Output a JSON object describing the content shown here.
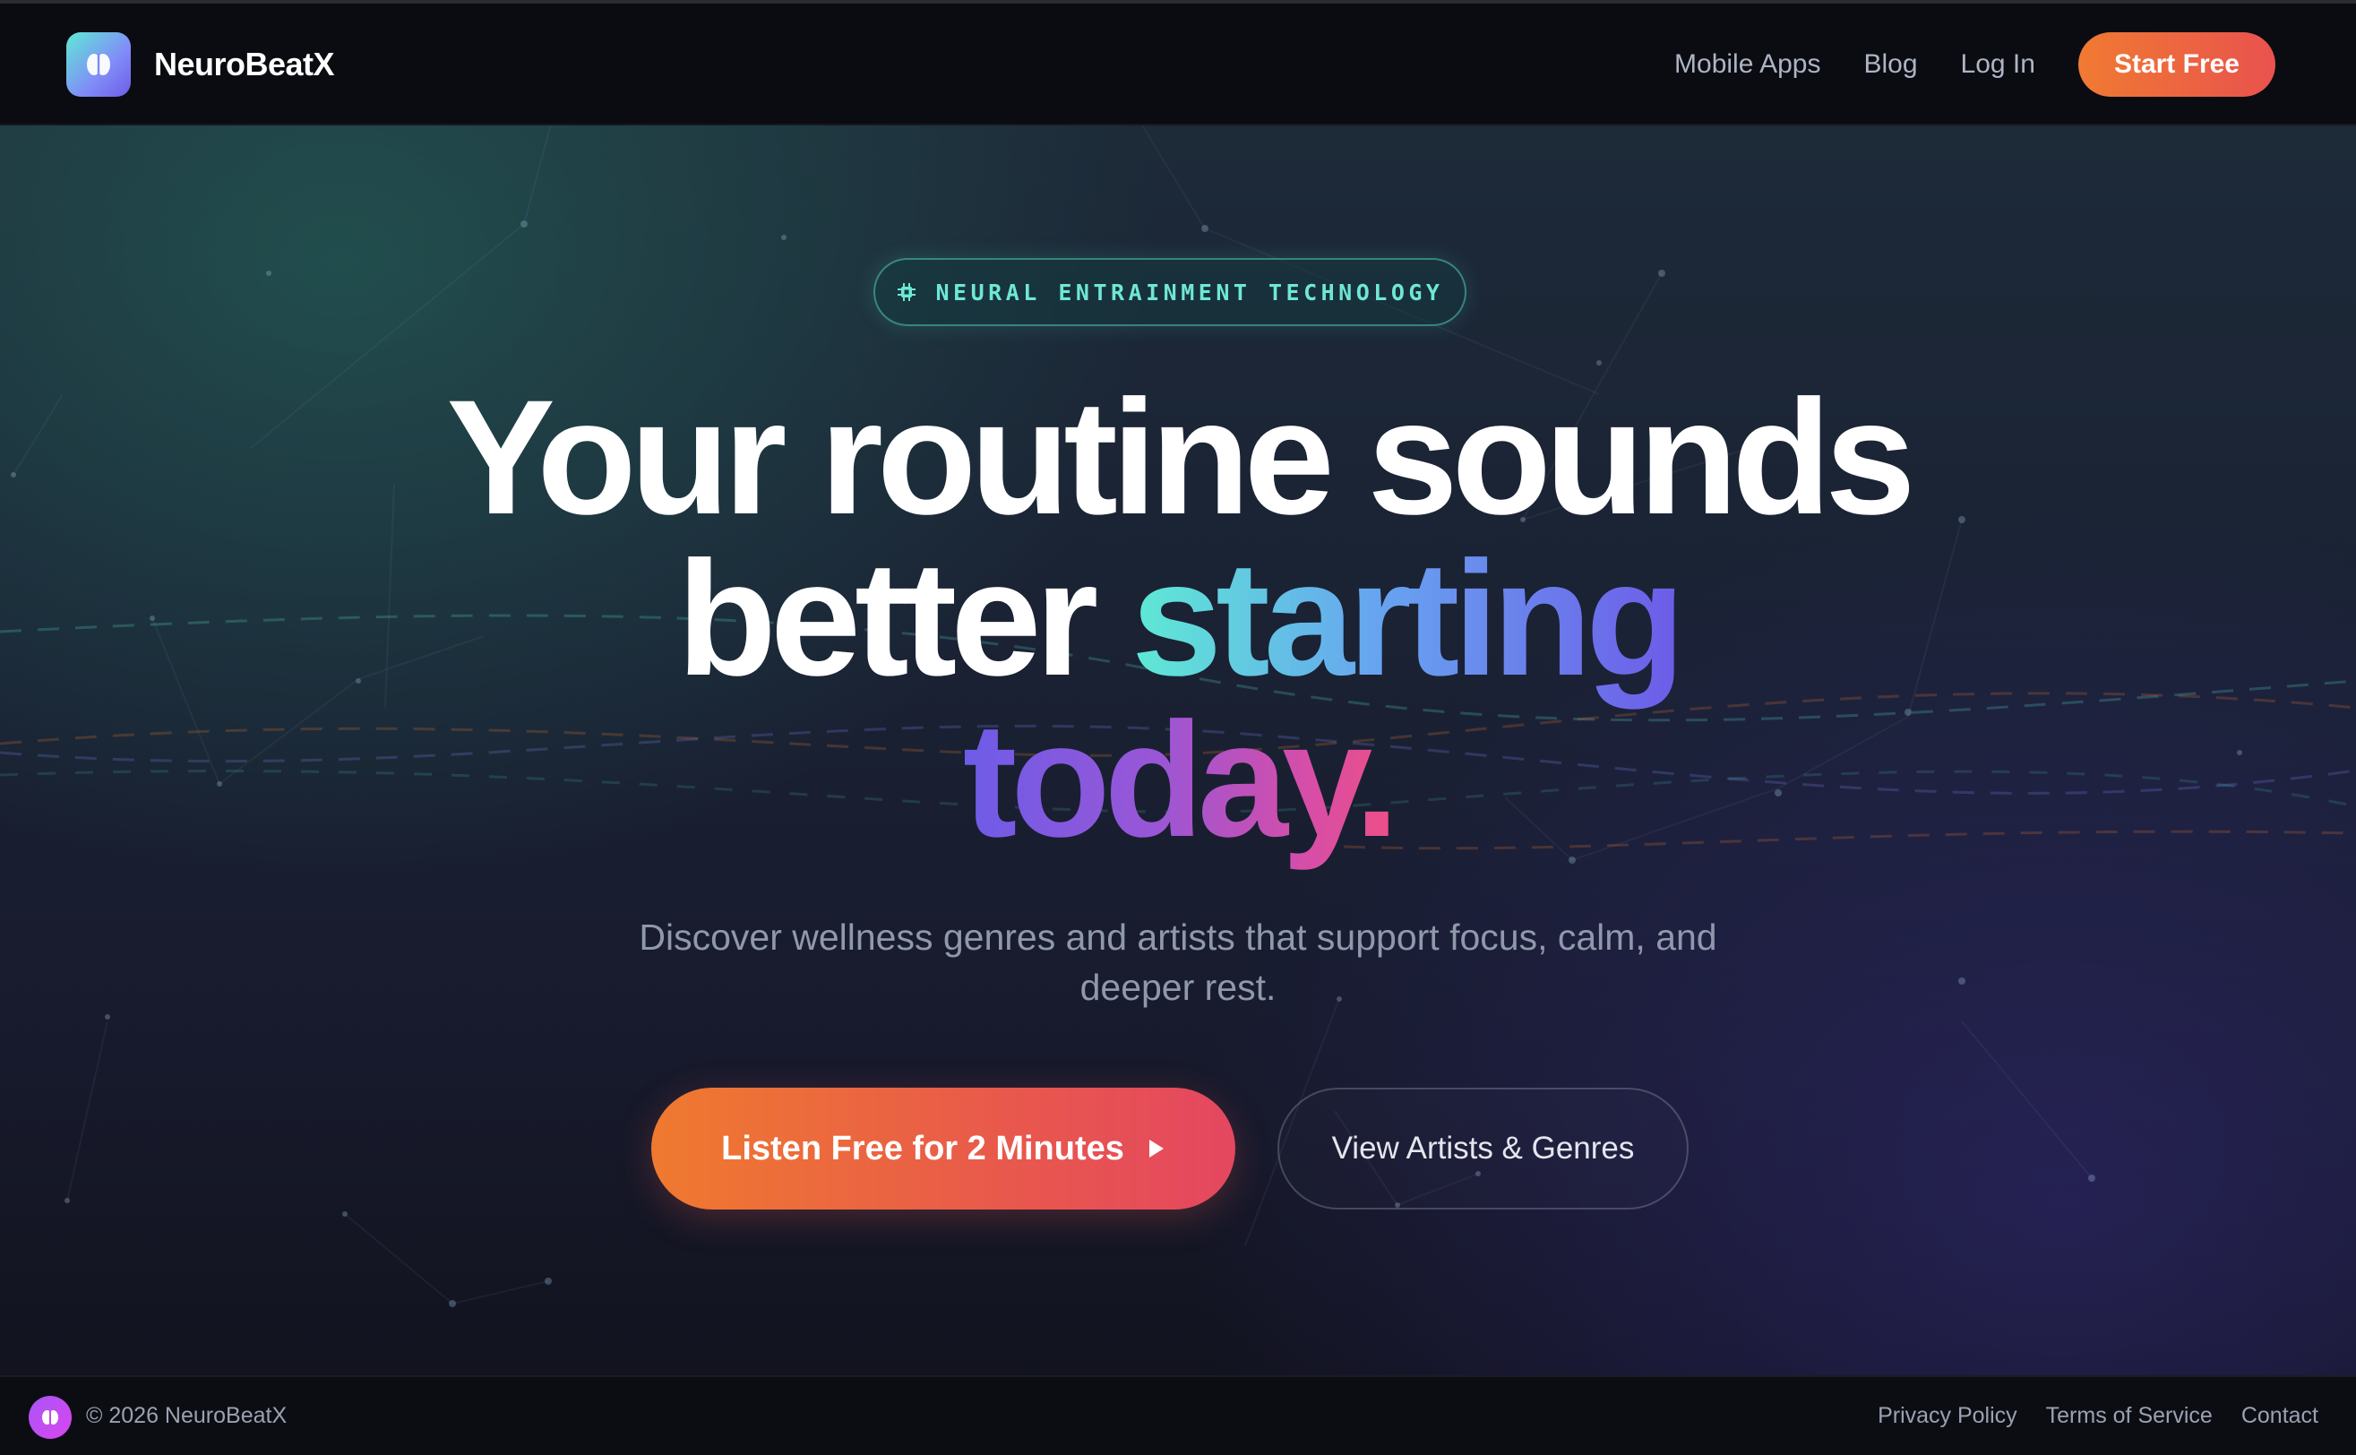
{
  "brand": {
    "name": "NeuroBeatX",
    "logo_icon": "brain-icon"
  },
  "nav": {
    "links": [
      "Mobile Apps",
      "Blog",
      "Log In"
    ],
    "cta": "Start Free"
  },
  "hero": {
    "badge": {
      "icon": "chip-icon",
      "text": "NEURAL ENTRAINMENT TECHNOLOGY"
    },
    "headline": {
      "line1": "Your routine sounds",
      "line2_plain": "better ",
      "line2_accent": "starting",
      "line3_accent": "today."
    },
    "subtitle": "Discover wellness genres and artists that support focus, calm, and deeper rest.",
    "primary_button": {
      "label": "Listen Free for 2 Minutes",
      "icon": "play-icon"
    },
    "secondary_button": {
      "label": "View Artists & Genres"
    }
  },
  "footer": {
    "logo_icon": "brain-icon",
    "copyright": "© 2026 NeuroBeatX",
    "links": [
      "Privacy Policy",
      "Terms of Service",
      "Contact"
    ]
  },
  "colors": {
    "accent_orange": "#ef7a2f",
    "accent_red": "#e8564e",
    "accent_teal": "#5eead4",
    "accent_indigo": "#6d5ce8",
    "accent_pink": "#ec4f86",
    "background": "#0b0d14"
  }
}
